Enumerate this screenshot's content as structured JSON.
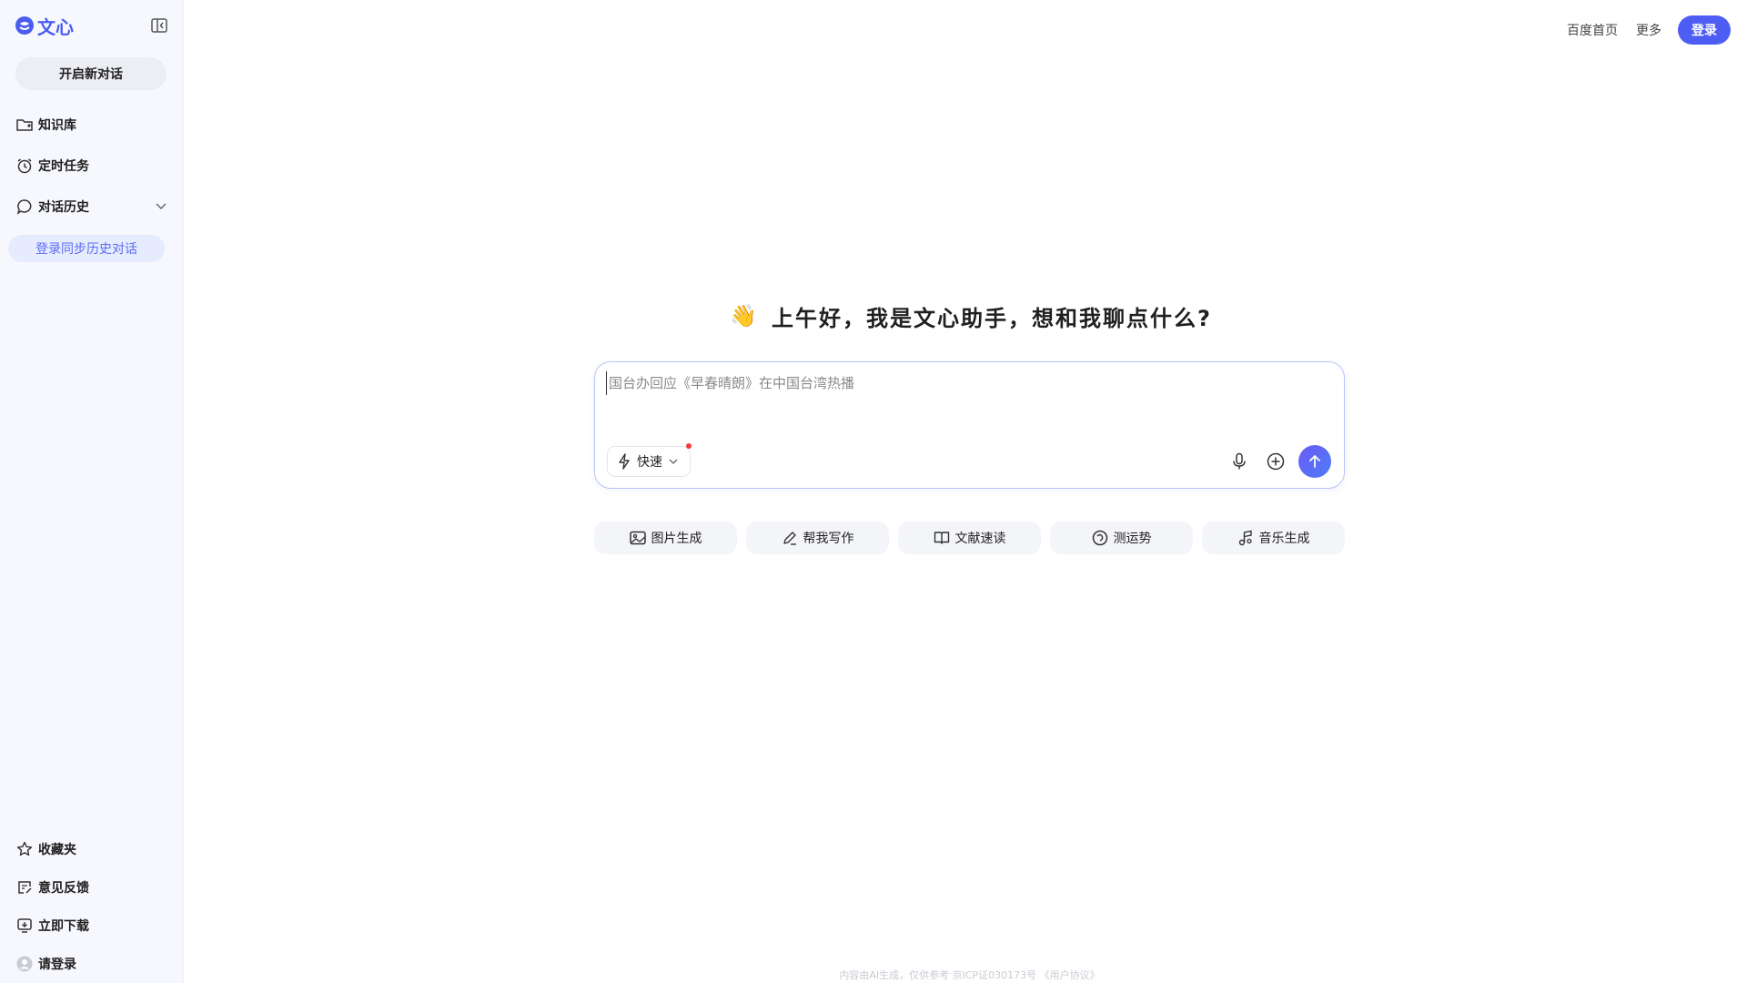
{
  "sidebar": {
    "logo_text": "文心",
    "new_chat_label": "开启新对话",
    "items": [
      {
        "label": "知识库",
        "icon": "folder-icon"
      },
      {
        "label": "定时任务",
        "icon": "alarm-clock-icon"
      },
      {
        "label": "对话历史",
        "icon": "chat-bubble-icon"
      }
    ],
    "sync_label": "登录同步历史对话",
    "bottom_items": [
      {
        "label": "收藏夹",
        "icon": "star-icon"
      },
      {
        "label": "意见反馈",
        "icon": "feedback-icon"
      },
      {
        "label": "立即下载",
        "icon": "download-icon"
      },
      {
        "label": "请登录",
        "icon": "avatar-icon"
      }
    ]
  },
  "header": {
    "links": [
      "百度首页",
      "更多"
    ],
    "login_label": "登录"
  },
  "main": {
    "greeting_emoji": "👋",
    "greeting": "上午好，我是文心助手，想和我聊点什么?",
    "input_placeholder": "国台办回应《早春晴朗》在中国台湾热播",
    "mode_label": "快速",
    "quick_actions": [
      {
        "label": "图片生成",
        "icon": "image-icon"
      },
      {
        "label": "帮我写作",
        "icon": "pen-icon"
      },
      {
        "label": "文献速读",
        "icon": "book-icon"
      },
      {
        "label": "测运势",
        "icon": "fortune-icon"
      },
      {
        "label": "音乐生成",
        "icon": "music-note-icon"
      }
    ]
  },
  "footer": {
    "text": "内容由AI生成，仅供参考 京ICP证030173号 《用户协议》"
  },
  "colors": {
    "accent": "#4e5ef5",
    "sidebar_bg": "#f7f8fd",
    "sync_pill_bg": "#e6ecfd",
    "notification_dot": "#f33b3b"
  }
}
